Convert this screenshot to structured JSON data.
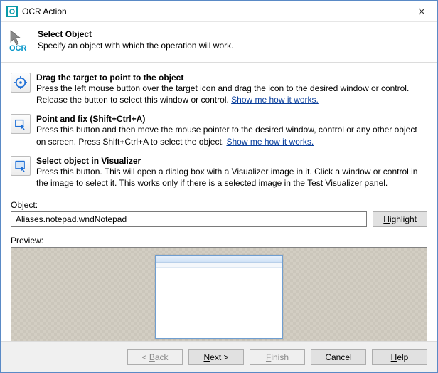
{
  "window": {
    "title": "OCR Action"
  },
  "header": {
    "title": "Select Object",
    "subtitle": "Specify an object with which the operation will work.",
    "icon_label": "OCR"
  },
  "options": {
    "drag": {
      "title": "Drag the target to point to the object",
      "desc_before_link": "Press the left mouse button over the target icon and drag the icon to the desired window or control. Release the button to select this window or control. ",
      "link": "Show me how it works."
    },
    "point": {
      "title": "Point and fix (Shift+Ctrl+A)",
      "desc_before_link": "Press this button and then move the mouse pointer to the desired window, control or any other object on screen. Press Shift+Ctrl+A to select the object. ",
      "link": "Show me how it works."
    },
    "visualizer": {
      "title": "Select object in Visualizer",
      "desc": "Press this button. This will open a dialog box with a Visualizer image in it. Click a window or control in the image to select it. This works only if there is a selected image in the Test Visualizer panel."
    }
  },
  "object": {
    "label": "Object:",
    "value": "Aliases.notepad.wndNotepad",
    "highlight": "Highlight"
  },
  "preview": {
    "label": "Preview:"
  },
  "footer": {
    "back": "< Back",
    "next": "Next >",
    "finish": "Finish",
    "cancel": "Cancel",
    "help": "Help"
  }
}
